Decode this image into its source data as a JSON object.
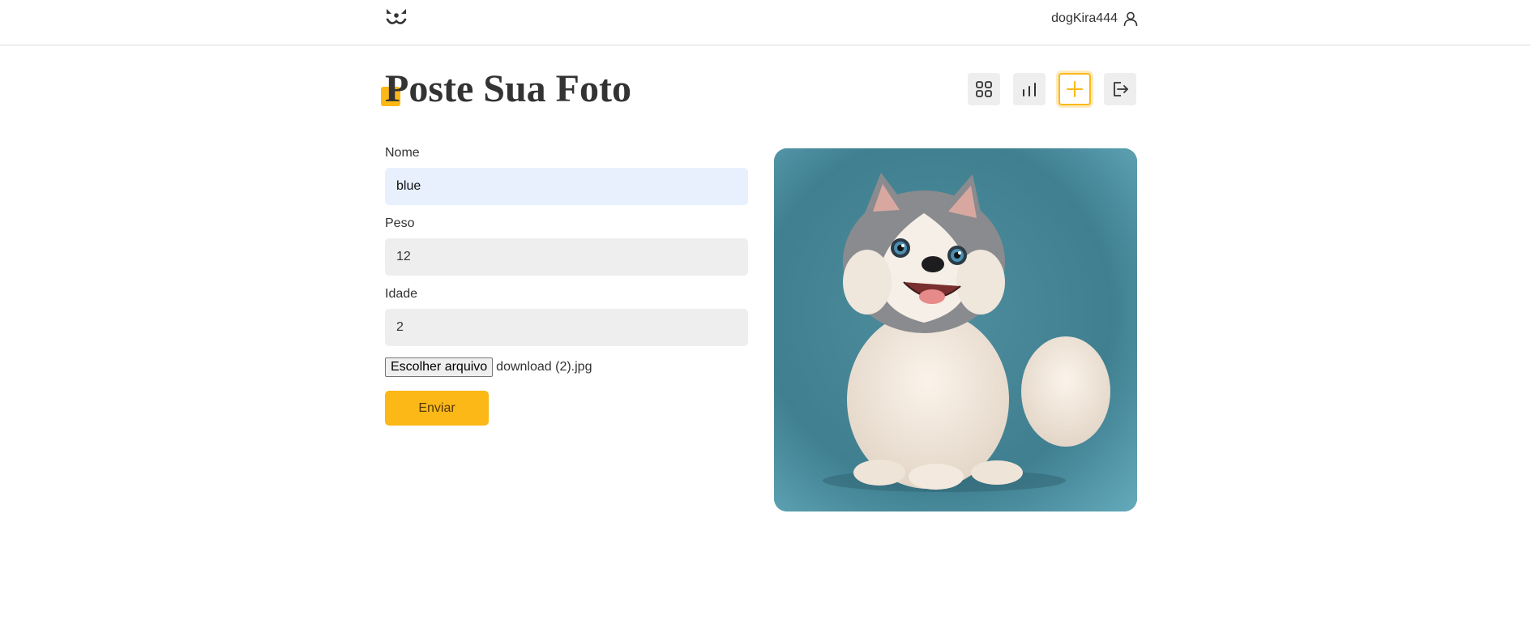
{
  "header": {
    "username": "dogKira444"
  },
  "page": {
    "title": "Poste Sua Foto"
  },
  "toolbar": {
    "items": [
      {
        "name": "feed",
        "icon": "grid-icon",
        "active": false
      },
      {
        "name": "stats",
        "icon": "bar-chart-icon",
        "active": false
      },
      {
        "name": "post",
        "icon": "plus-icon",
        "active": true
      },
      {
        "name": "logout",
        "icon": "logout-icon",
        "active": false
      }
    ]
  },
  "form": {
    "nome_label": "Nome",
    "nome_value": "blue",
    "peso_label": "Peso",
    "peso_value": "12",
    "idade_label": "Idade",
    "idade_value": "2",
    "file_button_label": "Escolher arquivo",
    "file_name": "download (2).jpg",
    "submit_label": "Enviar"
  },
  "colors": {
    "accent": "#fbb817",
    "button_bg": "#eeeeee",
    "autofill_bg": "#e8f0fe",
    "preview_bg": "#3d7d8d"
  }
}
